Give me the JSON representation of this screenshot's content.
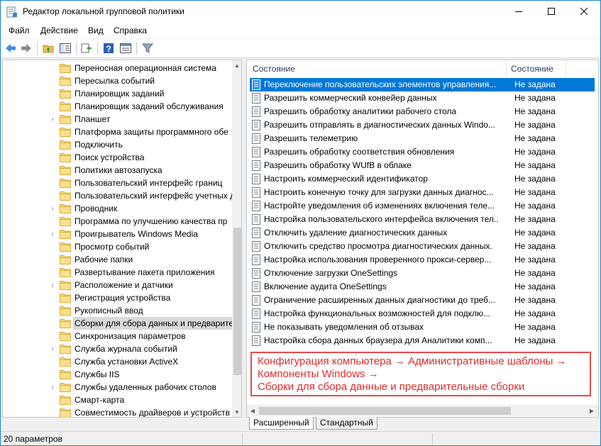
{
  "window": {
    "title": "Редактор локальной групповой политики"
  },
  "menu": [
    "Файл",
    "Действие",
    "Вид",
    "Справка"
  ],
  "toolbar": [
    "back-icon",
    "forward-icon",
    "up-folder-icon",
    "show-hide-tree-icon",
    "export-list-icon",
    "help-icon",
    "console-tree-icon",
    "filter-icon"
  ],
  "tree": {
    "items": [
      {
        "label": "Переносная операционная система",
        "expandable": false
      },
      {
        "label": "Пересылка событий",
        "expandable": false
      },
      {
        "label": "Планировщик заданий",
        "expandable": false
      },
      {
        "label": "Планировщик заданий обслуживания",
        "expandable": false
      },
      {
        "label": "Планшет",
        "expandable": true
      },
      {
        "label": "Платформа защиты программного обе",
        "expandable": false
      },
      {
        "label": "Подключить",
        "expandable": false
      },
      {
        "label": "Поиск устройства",
        "expandable": false
      },
      {
        "label": "Политики автозапуска",
        "expandable": false
      },
      {
        "label": "Пользовательский интерфейс границ",
        "expandable": false
      },
      {
        "label": "Пользовательский интерфейс учетных д",
        "expandable": false
      },
      {
        "label": "Проводник",
        "expandable": true
      },
      {
        "label": "Программа по улучшению качества пр",
        "expandable": false
      },
      {
        "label": "Проигрыватель Windows Media",
        "expandable": true
      },
      {
        "label": "Просмотр событий",
        "expandable": false
      },
      {
        "label": "Рабочие папки",
        "expandable": false
      },
      {
        "label": "Развертывание пакета приложения",
        "expandable": false
      },
      {
        "label": "Расположение и датчики",
        "expandable": true
      },
      {
        "label": "Регистрация устройства",
        "expandable": false
      },
      {
        "label": "Рукописный ввод",
        "expandable": false
      },
      {
        "label": "Сборки для сбора данных и предварител",
        "expandable": false,
        "selected": true
      },
      {
        "label": "Синхронизация параметров",
        "expandable": false
      },
      {
        "label": "Служба журнала событий",
        "expandable": true
      },
      {
        "label": "Служба установки ActiveX",
        "expandable": false
      },
      {
        "label": "Службы IIS",
        "expandable": false
      },
      {
        "label": "Службы удаленных рабочих столов",
        "expandable": true
      },
      {
        "label": "Смарт-карта",
        "expandable": false
      },
      {
        "label": "Совместимость драйверов и устройств",
        "expandable": false
      }
    ]
  },
  "list": {
    "header_name": "Состояние",
    "header_state": "Состояние",
    "rows": [
      {
        "name": "Переключение пользовательских элементов управления...",
        "state": "Не задана",
        "selected": true
      },
      {
        "name": "Разрешить коммерческий конвейер данных",
        "state": "Не задана"
      },
      {
        "name": "Разрешить обработку аналитики рабочего стола",
        "state": "Не задана"
      },
      {
        "name": "Разрешить отправлять в диагностических данных Windo...",
        "state": "Не задана"
      },
      {
        "name": "Разрешить телеметрию",
        "state": "Не задана"
      },
      {
        "name": "Разрешить обработку соответствия обновления",
        "state": "Не задана"
      },
      {
        "name": "Разрешить обработку WUfB в облаке",
        "state": "Не задана"
      },
      {
        "name": "Настроить коммерческий идентификатор",
        "state": "Не задана"
      },
      {
        "name": "Настроить конечную точку для загрузки данных диагнос...",
        "state": "Не задана"
      },
      {
        "name": "Настройте уведомления об изменениях включения теле...",
        "state": "Не задана"
      },
      {
        "name": "Настройка пользовательского интерфейса включения тел...",
        "state": "Не задана"
      },
      {
        "name": "Отключить удаление диагностических данных",
        "state": "Не задана"
      },
      {
        "name": "Отключить средство просмотра диагностических данных.",
        "state": "Не задана"
      },
      {
        "name": "Настройка использования проверенного прокси-сервер...",
        "state": "Не задана"
      },
      {
        "name": "Отключение загрузки OneSettings",
        "state": "Не задана"
      },
      {
        "name": "Включение аудита OneSettings",
        "state": "Не задана"
      },
      {
        "name": "Ограничение расширенных данных диагностики до треб...",
        "state": "Не задана"
      },
      {
        "name": "Настройка функциональных возможностей для подклю...",
        "state": "Не задана"
      },
      {
        "name": "Не показывать уведомления об отзывах",
        "state": "Не задана"
      },
      {
        "name": "Настройка сбора данных браузера для Аналитики комп...",
        "state": "Не задана"
      }
    ]
  },
  "note": {
    "line1": "Конфигурация компьютера → Административные шаблоны →",
    "line2": "Компоненты Windows →",
    "line3": "Сборки для сбора данные и предварительные сборки"
  },
  "tabs": [
    "Расширенный",
    "Стандартный"
  ],
  "status": {
    "text": "20 параметров"
  }
}
